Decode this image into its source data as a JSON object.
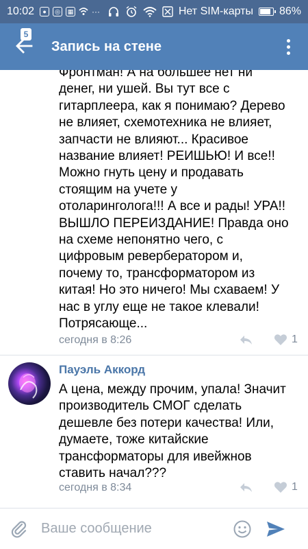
{
  "status_bar": {
    "time": "10:02",
    "carrier": "Нет SIM-карты",
    "battery": "86%",
    "battery_level": 0.86
  },
  "toolbar": {
    "title": "Запись на стене",
    "back_badge": "5"
  },
  "comments": [
    {
      "text": "Фронтман! А на большее нет ни\nденег, ни ушей. Вы тут все с\nгитарплеера, как я понимаю? Дерево\nне влияет, схемотехника не влияет,\nзапчасти не влияют... Красивое\nназвание влияет! РЕИШЬЮ! И все!!\nМожно гнуть цену и продавать\nстоящим на учете у\nотоларинголога!!! А все и рады! УРА!!\nВЫШЛО ПЕРЕИЗДАНИЕ! Правда оно\nна схеме непонятно чего, с\nцифровым ревербератором и,\nпочему то, трансформатором из\nкитая! Но это ничего! Мы схаваем! У\nнас в углу еще не такое клевали!\nПотрясающе...",
      "date": "сегодня в 8:26",
      "likes": "1"
    },
    {
      "author": "Пауэль Аккорд",
      "text": "А цена, между прочим, упала! Значит\nпроизводитель СМОГ сделать\nдешевле без потери качества! Или,\nдумаете, тоже китайские\nтрансформаторы для ивейжнов\nставить начал???",
      "date": "сегодня в 8:34",
      "likes": "1"
    }
  ],
  "composer": {
    "placeholder": "Ваше сообщение"
  },
  "colors": {
    "statusbar": "#4a6993",
    "toolbar": "#5181b8",
    "author": "#4a76a8",
    "meta": "#7e8a99",
    "send": "#5181b8"
  },
  "icons": [
    "back-arrow-icon",
    "more-vert-icon",
    "reply-icon",
    "heart-icon",
    "paperclip-icon",
    "emoji-icon",
    "send-icon"
  ]
}
